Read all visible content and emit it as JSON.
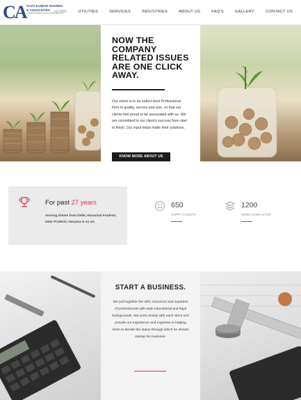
{
  "brand": {
    "logo_mark": "CA",
    "name_line1": "VIJAY KUMAR SHARMA",
    "name_line2": "& ASSOCIATES",
    "tagline": "CHARTERED ACCOUNTANTS"
  },
  "nav": {
    "items": [
      {
        "label": "HOME"
      },
      {
        "label": "UTILITIES"
      },
      {
        "label": "SERVICES"
      },
      {
        "label": "INDUSTRIES"
      },
      {
        "label": "ABOUT US"
      },
      {
        "label": "FAQ'S"
      },
      {
        "label": "GALLERY"
      },
      {
        "label": "CONTACT US"
      }
    ],
    "active": "HOME"
  },
  "hero": {
    "title": "NOW THE COMPANY RELATED ISSUES ARE ONE CLICK AWAY.",
    "body": "Our vision is to be India's best Professional Firm in quality, service and size, so that our clients feel proud to be associated with us. We are committed to our client's success from start to finish. Our input helps make their solutions.",
    "button": "KNOW MORE ABOUT US"
  },
  "past": {
    "title_prefix": "For past ",
    "years": "27 years",
    "body": "Serving clients from Delhi, Himachal Pradesh, Uttar Pradesh, Haryana & so on.",
    "icon": "trophy-icon"
  },
  "stats": [
    {
      "value": "650",
      "label": "HAPPY CLIENTS",
      "icon": "smiley-icon"
    },
    {
      "value": "1200",
      "label": "WORK COMPLETED",
      "icon": "layers-icon"
    }
  ],
  "business": {
    "title": "START A BUSINESS.",
    "body": "We pull together the skill, resources and expertise of professionals with wide educational and legal backgrounds. We work closely with each client and provide our experience and expertise in helping them to decide the status through which he should startup his business."
  },
  "colors": {
    "accent": "#d6324a",
    "dark_button": "#1c1c1c",
    "logo_blue": "#2a4a8a",
    "logo_green": "#3aa655"
  }
}
